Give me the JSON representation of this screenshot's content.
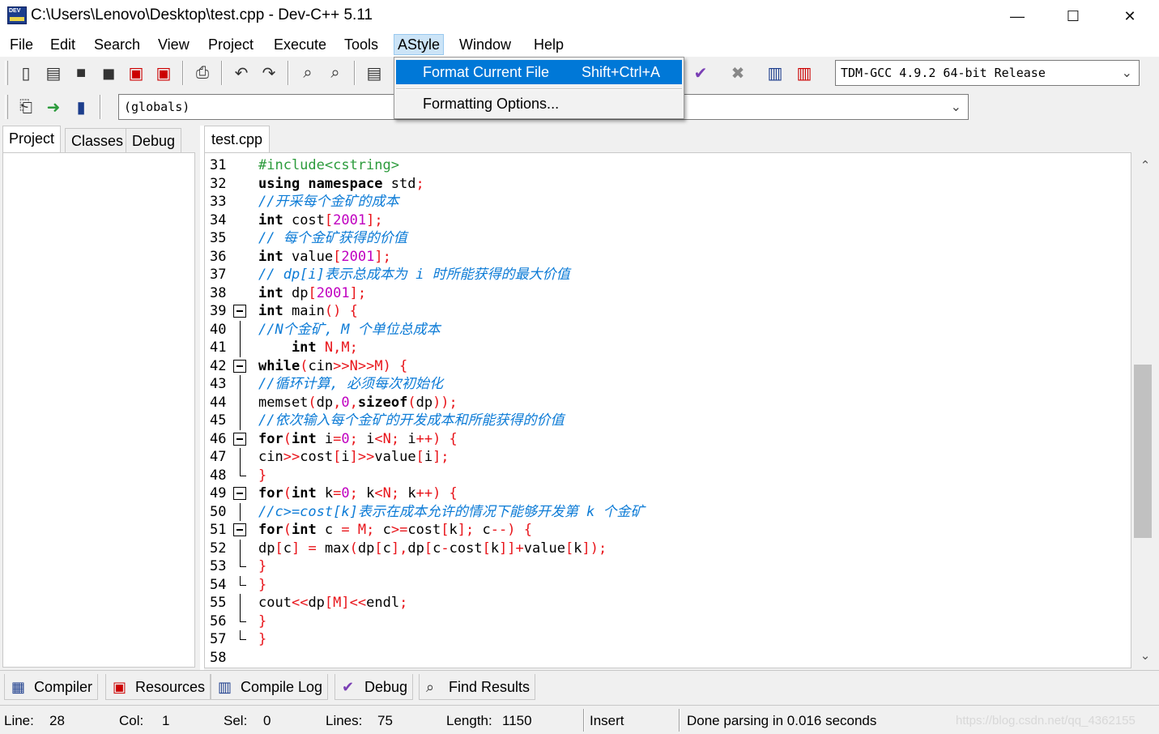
{
  "window": {
    "title": "C:\\Users\\Lenovo\\Desktop\\test.cpp - Dev-C++ 5.11",
    "minimize": "—",
    "maximize": "☐",
    "close": "✕"
  },
  "menu": [
    "File",
    "Edit",
    "Search",
    "View",
    "Project",
    "Execute",
    "Tools",
    "AStyle",
    "Window",
    "Help"
  ],
  "astyle_menu": {
    "format_label": "Format Current File",
    "format_shortcut": "Shift+Ctrl+A",
    "options_label": "Formatting Options..."
  },
  "toolbar": {
    "compiler_select": "TDM-GCC 4.9.2 64-bit Release",
    "scope_select": "(globals)"
  },
  "left_tabs": [
    "Project",
    "Classes",
    "Debug"
  ],
  "file_tab": "test.cpp",
  "code_lines": [
    {
      "n": "31",
      "tokens": [
        {
          "c": "pre",
          "t": "#include<cstring>"
        }
      ]
    },
    {
      "n": "32",
      "tokens": [
        {
          "c": "kw",
          "t": "using namespace"
        },
        {
          "c": "idn",
          "t": " std"
        },
        {
          "c": "sym",
          "t": ";"
        }
      ]
    },
    {
      "n": "33",
      "tokens": [
        {
          "c": "cmt",
          "t": "//开采每个金矿的成本"
        }
      ]
    },
    {
      "n": "34",
      "tokens": [
        {
          "c": "kw",
          "t": "int"
        },
        {
          "c": "idn",
          "t": " cost"
        },
        {
          "c": "sym",
          "t": "["
        },
        {
          "c": "num",
          "t": "2001"
        },
        {
          "c": "sym",
          "t": "];"
        }
      ]
    },
    {
      "n": "35",
      "tokens": [
        {
          "c": "cmt",
          "t": "// 每个金矿获得的价值"
        }
      ]
    },
    {
      "n": "36",
      "tokens": [
        {
          "c": "kw",
          "t": "int"
        },
        {
          "c": "idn",
          "t": " value"
        },
        {
          "c": "sym",
          "t": "["
        },
        {
          "c": "num",
          "t": "2001"
        },
        {
          "c": "sym",
          "t": "];"
        }
      ]
    },
    {
      "n": "37",
      "tokens": [
        {
          "c": "cmt",
          "t": "// dp[i]表示总成本为 i 时所能获得的最大价值"
        }
      ]
    },
    {
      "n": "38",
      "tokens": [
        {
          "c": "kw",
          "t": "int"
        },
        {
          "c": "idn",
          "t": " dp"
        },
        {
          "c": "sym",
          "t": "["
        },
        {
          "c": "num",
          "t": "2001"
        },
        {
          "c": "sym",
          "t": "];"
        }
      ]
    },
    {
      "n": "39",
      "fold": "open",
      "tokens": [
        {
          "c": "kw",
          "t": "int"
        },
        {
          "c": "idn",
          "t": " main"
        },
        {
          "c": "sym",
          "t": "() {"
        }
      ]
    },
    {
      "n": "40",
      "fold": "line",
      "tokens": [
        {
          "c": "cmt",
          "t": "//N个金矿, M 个单位总成本"
        }
      ]
    },
    {
      "n": "41",
      "fold": "line",
      "tokens": [
        {
          "c": "kw",
          "t": "    int"
        },
        {
          "c": "sym",
          "t": " N,M;"
        }
      ]
    },
    {
      "n": "42",
      "fold": "open",
      "tokens": [
        {
          "c": "kw",
          "t": "while"
        },
        {
          "c": "sym",
          "t": "("
        },
        {
          "c": "idn",
          "t": "cin"
        },
        {
          "c": "sym",
          "t": ">>N>>M) {"
        }
      ]
    },
    {
      "n": "43",
      "fold": "line",
      "tokens": [
        {
          "c": "cmt",
          "t": "//循环计算, 必须每次初始化"
        }
      ]
    },
    {
      "n": "44",
      "fold": "line",
      "tokens": [
        {
          "c": "idn",
          "t": "memset"
        },
        {
          "c": "sym",
          "t": "("
        },
        {
          "c": "idn",
          "t": "dp"
        },
        {
          "c": "sym",
          "t": ","
        },
        {
          "c": "num",
          "t": "0"
        },
        {
          "c": "sym",
          "t": ","
        },
        {
          "c": "kw",
          "t": "sizeof"
        },
        {
          "c": "sym",
          "t": "("
        },
        {
          "c": "idn",
          "t": "dp"
        },
        {
          "c": "sym",
          "t": "));"
        }
      ]
    },
    {
      "n": "45",
      "fold": "line",
      "tokens": [
        {
          "c": "cmt",
          "t": "//依次输入每个金矿的开发成本和所能获得的价值"
        }
      ]
    },
    {
      "n": "46",
      "fold": "open",
      "tokens": [
        {
          "c": "kw",
          "t": "for"
        },
        {
          "c": "sym",
          "t": "("
        },
        {
          "c": "kw",
          "t": "int"
        },
        {
          "c": "idn",
          "t": " i"
        },
        {
          "c": "sym",
          "t": "="
        },
        {
          "c": "num",
          "t": "0"
        },
        {
          "c": "sym",
          "t": "; "
        },
        {
          "c": "idn",
          "t": "i"
        },
        {
          "c": "sym",
          "t": "<N; "
        },
        {
          "c": "idn",
          "t": "i"
        },
        {
          "c": "sym",
          "t": "++) {"
        }
      ]
    },
    {
      "n": "47",
      "fold": "line",
      "tokens": [
        {
          "c": "idn",
          "t": "cin"
        },
        {
          "c": "sym",
          "t": ">>"
        },
        {
          "c": "idn",
          "t": "cost"
        },
        {
          "c": "sym",
          "t": "["
        },
        {
          "c": "idn",
          "t": "i"
        },
        {
          "c": "sym",
          "t": "]>>"
        },
        {
          "c": "idn",
          "t": "value"
        },
        {
          "c": "sym",
          "t": "["
        },
        {
          "c": "idn",
          "t": "i"
        },
        {
          "c": "sym",
          "t": "];"
        }
      ]
    },
    {
      "n": "48",
      "fold": "end",
      "tokens": [
        {
          "c": "sym",
          "t": "}"
        }
      ]
    },
    {
      "n": "49",
      "fold": "open",
      "tokens": [
        {
          "c": "kw",
          "t": "for"
        },
        {
          "c": "sym",
          "t": "("
        },
        {
          "c": "kw",
          "t": "int"
        },
        {
          "c": "idn",
          "t": " k"
        },
        {
          "c": "sym",
          "t": "="
        },
        {
          "c": "num",
          "t": "0"
        },
        {
          "c": "sym",
          "t": "; "
        },
        {
          "c": "idn",
          "t": "k"
        },
        {
          "c": "sym",
          "t": "<N; "
        },
        {
          "c": "idn",
          "t": "k"
        },
        {
          "c": "sym",
          "t": "++) {"
        }
      ]
    },
    {
      "n": "50",
      "fold": "line",
      "tokens": [
        {
          "c": "cmt",
          "t": "//c>=cost[k]表示在成本允许的情况下能够开发第 k 个金矿"
        }
      ]
    },
    {
      "n": "51",
      "fold": "open",
      "tokens": [
        {
          "c": "kw",
          "t": "for"
        },
        {
          "c": "sym",
          "t": "("
        },
        {
          "c": "kw",
          "t": "int"
        },
        {
          "c": "idn",
          "t": " c"
        },
        {
          "c": "sym",
          "t": " = M; "
        },
        {
          "c": "idn",
          "t": "c"
        },
        {
          "c": "sym",
          "t": ">="
        },
        {
          "c": "idn",
          "t": "cost"
        },
        {
          "c": "sym",
          "t": "["
        },
        {
          "c": "idn",
          "t": "k"
        },
        {
          "c": "sym",
          "t": "]; "
        },
        {
          "c": "idn",
          "t": "c"
        },
        {
          "c": "sym",
          "t": "--) {"
        }
      ]
    },
    {
      "n": "52",
      "fold": "line",
      "tokens": [
        {
          "c": "idn",
          "t": "dp"
        },
        {
          "c": "sym",
          "t": "["
        },
        {
          "c": "idn",
          "t": "c"
        },
        {
          "c": "sym",
          "t": "] = "
        },
        {
          "c": "idn",
          "t": "max"
        },
        {
          "c": "sym",
          "t": "("
        },
        {
          "c": "idn",
          "t": "dp"
        },
        {
          "c": "sym",
          "t": "["
        },
        {
          "c": "idn",
          "t": "c"
        },
        {
          "c": "sym",
          "t": "],"
        },
        {
          "c": "idn",
          "t": "dp"
        },
        {
          "c": "sym",
          "t": "["
        },
        {
          "c": "idn",
          "t": "c"
        },
        {
          "c": "sym",
          "t": "-"
        },
        {
          "c": "idn",
          "t": "cost"
        },
        {
          "c": "sym",
          "t": "["
        },
        {
          "c": "idn",
          "t": "k"
        },
        {
          "c": "sym",
          "t": "]]+"
        },
        {
          "c": "idn",
          "t": "value"
        },
        {
          "c": "sym",
          "t": "["
        },
        {
          "c": "idn",
          "t": "k"
        },
        {
          "c": "sym",
          "t": "]);"
        }
      ]
    },
    {
      "n": "53",
      "fold": "end",
      "tokens": [
        {
          "c": "sym",
          "t": "}"
        }
      ]
    },
    {
      "n": "54",
      "fold": "end",
      "tokens": [
        {
          "c": "sym",
          "t": "}"
        }
      ]
    },
    {
      "n": "55",
      "fold": "line",
      "tokens": [
        {
          "c": "idn",
          "t": "cout"
        },
        {
          "c": "sym",
          "t": "<<"
        },
        {
          "c": "idn",
          "t": "dp"
        },
        {
          "c": "sym",
          "t": "[M]<<"
        },
        {
          "c": "idn",
          "t": "endl"
        },
        {
          "c": "sym",
          "t": ";"
        }
      ]
    },
    {
      "n": "56",
      "fold": "end",
      "tokens": [
        {
          "c": "sym",
          "t": "}"
        }
      ]
    },
    {
      "n": "57",
      "fold": "end",
      "tokens": [
        {
          "c": "sym",
          "t": "}"
        }
      ]
    },
    {
      "n": "58",
      "tokens": []
    }
  ],
  "bottom_tabs": [
    "Compiler",
    "Resources",
    "Compile Log",
    "Debug",
    "Find Results"
  ],
  "status": {
    "line_label": "Line:",
    "line_value": "28",
    "col_label": "Col:",
    "col_value": "1",
    "sel_label": "Sel:",
    "sel_value": "0",
    "lines_label": "Lines:",
    "lines_value": "75",
    "length_label": "Length:",
    "length_value": "1150",
    "mode": "Insert",
    "message": "Done parsing in 0.016 seconds",
    "watermark": "https://blog.csdn.net/qq_4362155"
  }
}
